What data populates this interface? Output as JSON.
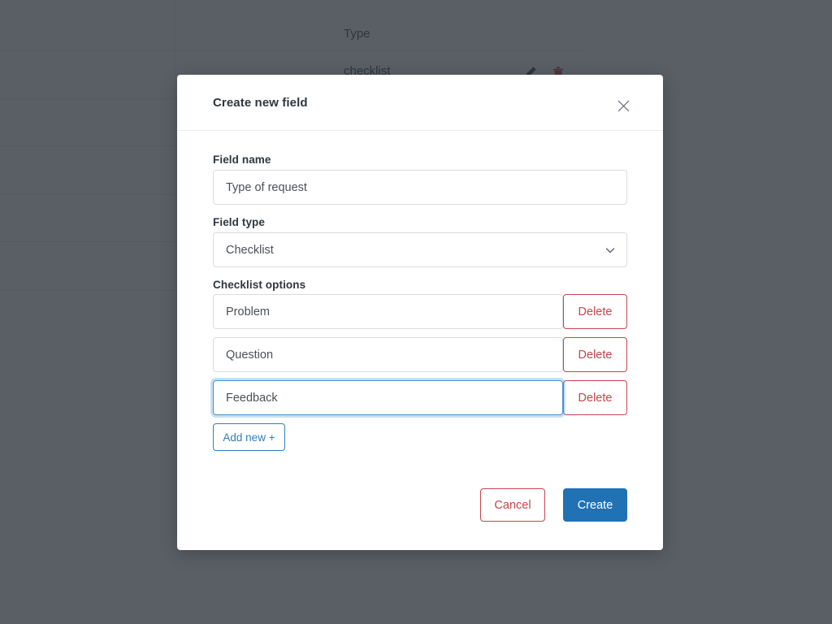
{
  "background": {
    "table": {
      "column_headers": [
        "Type"
      ],
      "rows": [
        {
          "type": "checklist",
          "edit_icon": "pencil-icon",
          "delete_icon": "trash-icon"
        }
      ]
    }
  },
  "modal": {
    "title": "Create new field",
    "close_icon": "close-icon",
    "form": {
      "field_name": {
        "label": "Field name",
        "value": "Type of request",
        "placeholder": "Field name"
      },
      "field_type": {
        "label": "Field type",
        "value": "Checklist",
        "chevron_icon": "chevron-down-icon"
      },
      "checklist": {
        "label": "Checklist options",
        "options": [
          {
            "value": "Problem",
            "delete_label": "Delete",
            "focused": false
          },
          {
            "value": "Question",
            "delete_label": "Delete",
            "focused": false
          },
          {
            "value": "Feedback",
            "delete_label": "Delete",
            "focused": true
          }
        ],
        "add_new_label": "Add new +"
      }
    },
    "footer": {
      "cancel_label": "Cancel",
      "create_label": "Create"
    }
  },
  "colors": {
    "scrim": "#4e555c",
    "primary": "#2171b5",
    "danger": "#c9434c",
    "link": "#2f7ebd",
    "focus_border": "#4a93d0",
    "text": "#2f363d",
    "border": "#d9dcdf"
  }
}
